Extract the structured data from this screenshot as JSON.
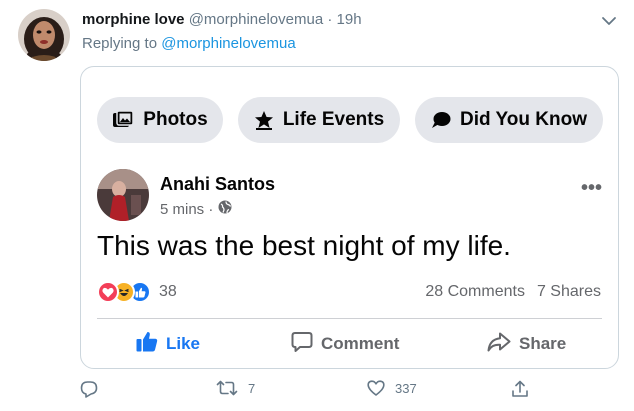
{
  "tweet": {
    "display_name": "morphine love",
    "handle": "@morphinelovemua",
    "separator": "·",
    "time": "19h",
    "replying_prefix": "Replying to",
    "replying_to": "@morphinelovemua"
  },
  "fb_card": {
    "pills": [
      {
        "label": "Photos",
        "icon": "photos-icon"
      },
      {
        "label": "Life Events",
        "icon": "star-icon"
      },
      {
        "label": "Did You Know",
        "icon": "speech-bubble-icon"
      }
    ],
    "poster_name": "Anahi Santos",
    "post_time": "5 mins ·",
    "audience_icon": "globe-icon",
    "post_text": "This was the best night of my life.",
    "reactions": [
      "love-reaction-icon",
      "haha-reaction-icon",
      "like-reaction-icon"
    ],
    "reaction_count": "38",
    "comments": "28 Comments",
    "shares": "7 Shares",
    "actions": {
      "like": "Like",
      "comment": "Comment",
      "share": "Share"
    }
  },
  "tweet_actions": {
    "reply_count": "",
    "retweet_count": "7",
    "like_count": "337"
  },
  "colors": {
    "twitter_blue": "#1b95e0",
    "facebook_blue": "#1877f2",
    "love_red": "#f33e58",
    "haha_yellow": "#f7b125",
    "muted_text": "#657786",
    "pill_bg": "#e4e6eb"
  }
}
